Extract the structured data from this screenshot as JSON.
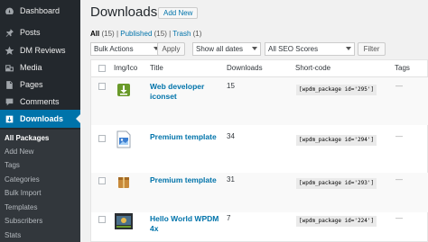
{
  "sidebar": {
    "items": [
      {
        "label": "Dashboard",
        "icon": "dashboard-icon"
      },
      {
        "label": "Posts",
        "icon": "pin-icon"
      },
      {
        "label": "DM Reviews",
        "icon": "star-icon"
      },
      {
        "label": "Media",
        "icon": "media-icon"
      },
      {
        "label": "Pages",
        "icon": "page-icon"
      },
      {
        "label": "Comments",
        "icon": "comment-icon"
      },
      {
        "label": "Downloads",
        "icon": "download-icon"
      }
    ],
    "submenu": [
      "All Packages",
      "Add New",
      "Tags",
      "Categories",
      "Bulk Import",
      "Templates",
      "Subscribers",
      "Stats"
    ]
  },
  "header": {
    "title": "Downloads",
    "add_new": "Add New"
  },
  "views": {
    "all": "All",
    "all_count": "(15)",
    "sep1": "|",
    "published": "Published",
    "published_count": "(15)",
    "sep2": "|",
    "trash": "Trash",
    "trash_count": "(1)"
  },
  "filters": {
    "bulk_actions": "Bulk Actions",
    "apply": "Apply",
    "dates": "Show all dates",
    "seo": "All SEO Scores",
    "filter": "Filter"
  },
  "table": {
    "columns": [
      "Img/Ico",
      "Title",
      "Downloads",
      "Short-code",
      "Tags"
    ],
    "rows": [
      {
        "title_line1": "Web developer",
        "title_line2": "iconset",
        "downloads": "15",
        "shortcode": "[wpdm_package id='295']",
        "tags": "—"
      },
      {
        "title_line1": "Premium template",
        "title_line2": "",
        "downloads": "34",
        "shortcode": "[wpdm_package id='294']",
        "tags": "—"
      },
      {
        "title_line1": "Premium template",
        "title_line2": "",
        "downloads": "31",
        "shortcode": "[wpdm_package id='293']",
        "tags": "—"
      },
      {
        "title_line1": "Hello World WPDM",
        "title_line2": "4x",
        "downloads": "7",
        "shortcode": "[wpdm_package id='224']",
        "tags": "—"
      }
    ]
  },
  "colors": {
    "sidebar_bg": "#23282d",
    "active_bg": "#0073aa",
    "link": "#0073aa"
  }
}
